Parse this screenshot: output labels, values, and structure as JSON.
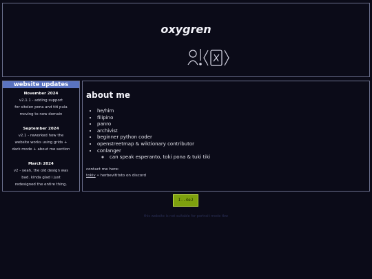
{
  "header": {
    "title": "oxygren"
  },
  "sidebar": {
    "heading": "website updates",
    "updates": [
      {
        "date": "November 2024",
        "lines": [
          "v2.1.1 - adding support",
          "for sitelen pona and titi pula",
          "moving to new domain"
        ]
      },
      {
        "date": "September 2024",
        "lines": [
          "v2.1 - reworked how the",
          "website works using grids +",
          "dark mode + about me section"
        ]
      },
      {
        "date": "March 2024",
        "lines": [
          "v2 - yeah, the old design was",
          "bad. kinda glad i just",
          "redesigned the entire thing."
        ]
      }
    ]
  },
  "main": {
    "title": "about me",
    "facts": [
      "he/him",
      "filipino",
      "panro",
      "archivist",
      "beginner python coder",
      "openstreetmap & wiktionary contributor",
      "conlanger"
    ],
    "subfact": "can speak esperanto, toki pona & tuki tiki",
    "contact_label": "contact me here:",
    "contact_link": "tokiv",
    "contact_rest": " • herbevititsto on discord"
  },
  "badge": {
    "label": "I-.4eJ"
  },
  "footer": {
    "text": "this website is not suitable for portrait mode tbw"
  }
}
